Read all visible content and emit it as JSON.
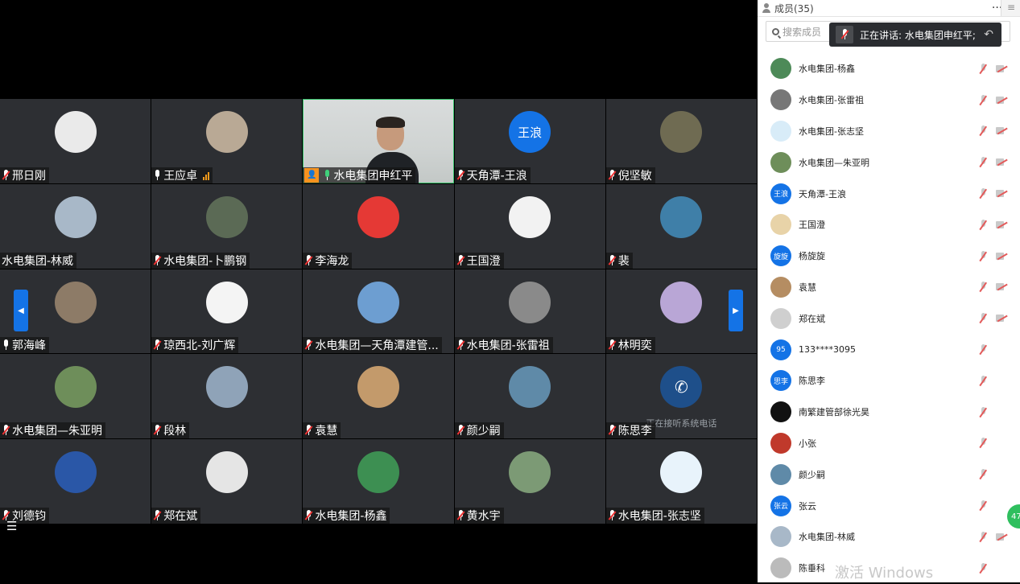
{
  "grid": {
    "tiles": [
      {
        "name": "邢日刚",
        "mic": "muted",
        "avatar_color": "#eaeaea"
      },
      {
        "name": "王应卓",
        "mic": "on-white",
        "avatar_color": "#b9a995",
        "signal": true
      },
      {
        "name": "水电集团申红平",
        "mic": "on",
        "video": true
      },
      {
        "name": "天角潭-王浪",
        "mic": "muted",
        "avatar_color": "#1473e6",
        "avatar_text": "王浪"
      },
      {
        "name": "倪坚敏",
        "mic": "muted",
        "avatar_color": "#6f6b52"
      },
      {
        "name": "水电集团-林威",
        "mic": "none",
        "avatar_color": "#a8b8c8"
      },
      {
        "name": "水电集团-卜鹏钢",
        "mic": "muted",
        "avatar_color": "#5b6a55"
      },
      {
        "name": "李海龙",
        "mic": "muted",
        "avatar_color": "#e53935"
      },
      {
        "name": "王国澄",
        "mic": "muted",
        "avatar_color": "#f2f2f2"
      },
      {
        "name": "裴",
        "mic": "muted",
        "avatar_color": "#3f7fa8"
      },
      {
        "name": "郭海峰",
        "mic": "on-white",
        "avatar_color": "#8d7b67"
      },
      {
        "name": "琼西北-刘广辉",
        "mic": "muted",
        "avatar_color": "#f4f4f4"
      },
      {
        "name": "水电集团—天角潭建管...",
        "mic": "muted",
        "avatar_color": "#6d9ed1"
      },
      {
        "name": "水电集团-张雷祖",
        "mic": "muted",
        "avatar_color": "#8a8a8a"
      },
      {
        "name": "林明奕",
        "mic": "muted",
        "avatar_color": "#b9a6d6"
      },
      {
        "name": "水电集团—朱亚明",
        "mic": "muted",
        "avatar_color": "#6e8e5a"
      },
      {
        "name": "段林",
        "mic": "muted",
        "avatar_color": "#8fa3b8"
      },
      {
        "name": "袁慧",
        "mic": "muted",
        "avatar_color": "#c39a6b"
      },
      {
        "name": "颜少嗣",
        "mic": "muted",
        "avatar_color": "#5f8aa8"
      },
      {
        "name": "陈思李",
        "mic": "muted",
        "avatar_color": "#1e4f8a",
        "phone_text": "正在接听系统电话"
      },
      {
        "name": "刘德钧",
        "mic": "muted",
        "avatar_color": "#2a57a7"
      },
      {
        "name": "郑在斌",
        "mic": "muted",
        "avatar_color": "#e5e5e5"
      },
      {
        "name": "水电集团-杨鑫",
        "mic": "muted",
        "avatar_color": "#3d8f52"
      },
      {
        "name": "黄水宇",
        "mic": "muted",
        "avatar_color": "#7c9a75"
      },
      {
        "name": "水电集团-张志坚",
        "mic": "muted",
        "avatar_color": "#e8f3fb"
      }
    ]
  },
  "panel": {
    "title": "成员(35)",
    "more": "···",
    "close": "✕",
    "menu": "≡",
    "search_placeholder": "搜索成员",
    "speaking": "正在讲话: 水电集团申红平;",
    "members": [
      {
        "name": "水电集团-杨鑫",
        "avatar_color": "#4d8a58",
        "cam": true
      },
      {
        "name": "水电集团-张雷祖",
        "avatar_color": "#777",
        "cam": true
      },
      {
        "name": "水电集团-张志坚",
        "avatar_color": "#d8ecf8",
        "cam": true
      },
      {
        "name": "水电集团—朱亚明",
        "avatar_color": "#6e8e5a",
        "cam": true
      },
      {
        "name": "天角潭-王浪",
        "avatar_color": "#1473e6",
        "avatar_text": "王浪",
        "cam": true
      },
      {
        "name": "王国澄",
        "avatar_color": "#e8d3a8",
        "cam": true
      },
      {
        "name": "杨旋旋",
        "avatar_color": "#1473e6",
        "avatar_text": "旋旋",
        "cam": true
      },
      {
        "name": "袁慧",
        "avatar_color": "#b58d62",
        "cam": true
      },
      {
        "name": "郑在斌",
        "avatar_color": "#cfcfcf",
        "cam": true
      },
      {
        "name": "133****3095",
        "avatar_color": "#1473e6",
        "avatar_text": "95",
        "cam": false
      },
      {
        "name": "陈思李",
        "avatar_color": "#1473e6",
        "avatar_text": "思李",
        "cam": false
      },
      {
        "name": "南繁建管部徐光昊",
        "avatar_color": "#111",
        "cam": false
      },
      {
        "name": "小张",
        "avatar_color": "#c0392b",
        "cam": false
      },
      {
        "name": "颜少嗣",
        "avatar_color": "#5f8aa8",
        "cam": false
      },
      {
        "name": "张云",
        "avatar_color": "#1473e6",
        "avatar_text": "张云",
        "cam": false
      },
      {
        "name": "水电集团-林威",
        "avatar_color": "#a8b8c8",
        "cam": true
      },
      {
        "name": "陈垂科",
        "avatar_color": "#bbb",
        "cam": false
      }
    ]
  },
  "watermark": "激活 Windows",
  "float_badge": "47"
}
